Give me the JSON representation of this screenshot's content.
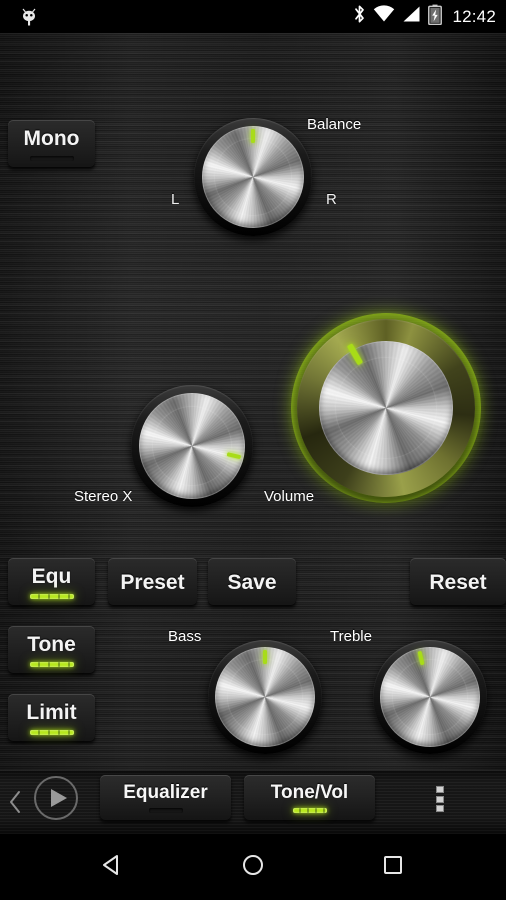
{
  "statusbar": {
    "time": "12:42",
    "left_icon": "android-robot-icon",
    "icons": [
      "bluetooth-icon",
      "wifi-icon",
      "cellular-signal-icon",
      "battery-charging-icon"
    ]
  },
  "app": {
    "title": "Tone/Vol",
    "accent_color": "#a8d818",
    "background_color": "#1d1d1d"
  },
  "toggles": {
    "mono": {
      "label": "Mono",
      "led": "off"
    },
    "equ": {
      "label": "Equ",
      "led": "on"
    },
    "tone": {
      "label": "Tone",
      "led": "on"
    },
    "limit": {
      "label": "Limit",
      "led": "on"
    }
  },
  "actions": {
    "preset": {
      "label": "Preset"
    },
    "save": {
      "label": "Save"
    },
    "reset": {
      "label": "Reset"
    }
  },
  "knobs": [
    {
      "id": "balance",
      "label": "Balance",
      "angle_deg": 0,
      "min_label": "L",
      "max_label": "R",
      "glow": "off"
    },
    {
      "id": "stereo_x",
      "label": "Stereo X",
      "angle_deg": 103,
      "glow": "off"
    },
    {
      "id": "volume",
      "label": "Volume",
      "angle_deg": -30,
      "glow": "on"
    },
    {
      "id": "bass",
      "label": "Bass",
      "angle_deg": 0,
      "glow": "off"
    },
    {
      "id": "treble",
      "label": "Treble",
      "angle_deg": -13,
      "glow": "off"
    }
  ],
  "tabbar": {
    "back_icon": "chevron-left-icon",
    "play_icon": "play-circle-icon",
    "overflow_icon": "overflow-menu-icon",
    "tabs": [
      {
        "label": "Equalizer",
        "active": false
      },
      {
        "label": "Tone/Vol",
        "active": true
      }
    ]
  },
  "navbar": {
    "back": "back-triangle-icon",
    "home": "home-circle-icon",
    "recents": "recents-square-icon"
  }
}
